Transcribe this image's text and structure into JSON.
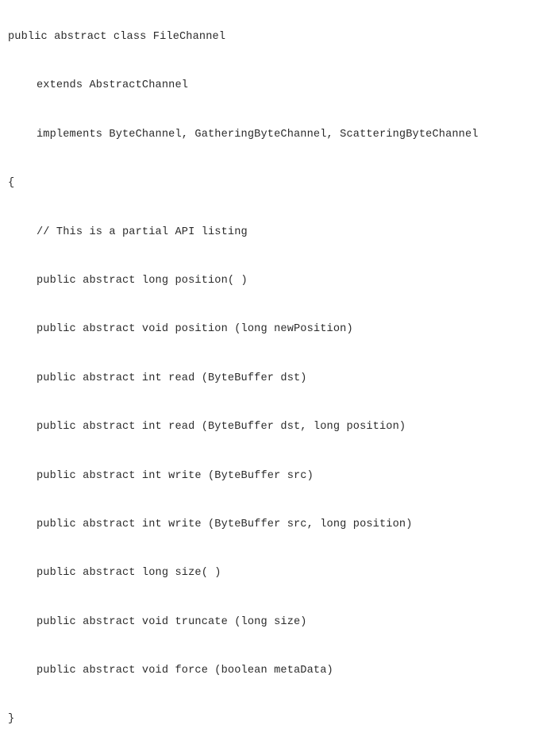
{
  "code": {
    "lines": [
      {
        "text": "public abstract class FileChannel",
        "indent": 0
      },
      {
        "text": "extends AbstractChannel",
        "indent": 1
      },
      {
        "text": "implements ByteChannel, GatheringByteChannel, ScatteringByteChannel",
        "indent": 1
      },
      {
        "text": "{",
        "indent": 0
      },
      {
        "text": "// This is a partial API listing",
        "indent": 1
      },
      {
        "text": "public abstract long position( )",
        "indent": 1
      },
      {
        "text": "public abstract void position (long newPosition)",
        "indent": 1
      },
      {
        "text": "public abstract int read (ByteBuffer dst)",
        "indent": 1
      },
      {
        "text": "public abstract int read (ByteBuffer dst, long position)",
        "indent": 1
      },
      {
        "text": "public abstract int write (ByteBuffer src)",
        "indent": 1
      },
      {
        "text": "public abstract int write (ByteBuffer src, long position)",
        "indent": 1
      },
      {
        "text": "public abstract long size( )",
        "indent": 1
      },
      {
        "text": "public abstract void truncate (long size)",
        "indent": 1
      },
      {
        "text": "public abstract void force (boolean metaData)",
        "indent": 1
      },
      {
        "text": "}",
        "indent": 0
      }
    ]
  }
}
